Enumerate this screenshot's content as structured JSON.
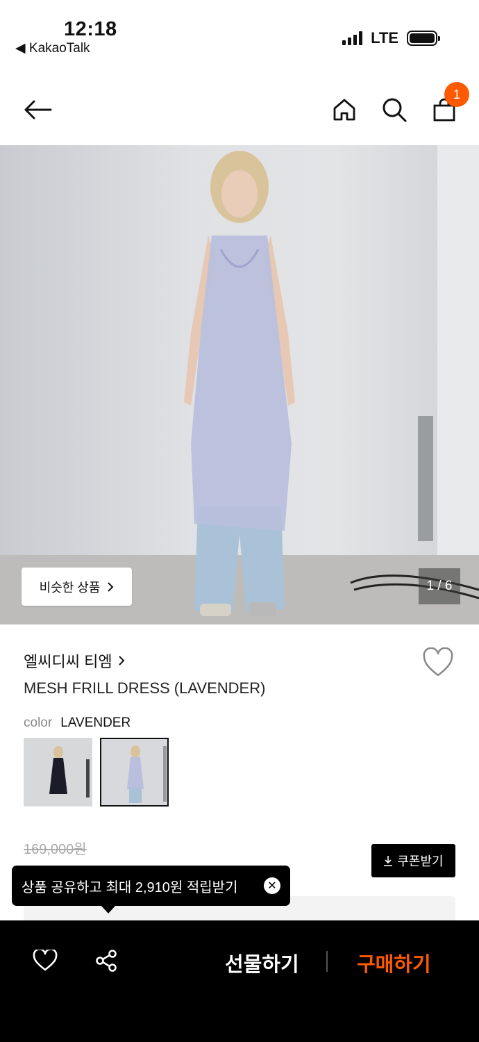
{
  "status_bar": {
    "time": "12:18",
    "back_app": "◀ KakaoTalk",
    "network": "LTE"
  },
  "header": {
    "cart_count": "1"
  },
  "gallery": {
    "similar_label": "비슷한 상품",
    "counter": "1 / 6"
  },
  "product": {
    "brand": "엘씨디씨 티엠",
    "title": "MESH FRILL DRESS (LAVENDER)",
    "color_label": "color",
    "color_value": "LAVENDER",
    "original_price": "169,000원"
  },
  "coupon": {
    "label": "쿠폰받기"
  },
  "tooltip": {
    "text": "상품 공유하고 최대 2,910원 적립받기"
  },
  "bottom_bar": {
    "gift_label": "선물하기",
    "buy_label": "구매하기"
  },
  "colors": {
    "accent": "#ff5a00",
    "dark": "#000000"
  }
}
